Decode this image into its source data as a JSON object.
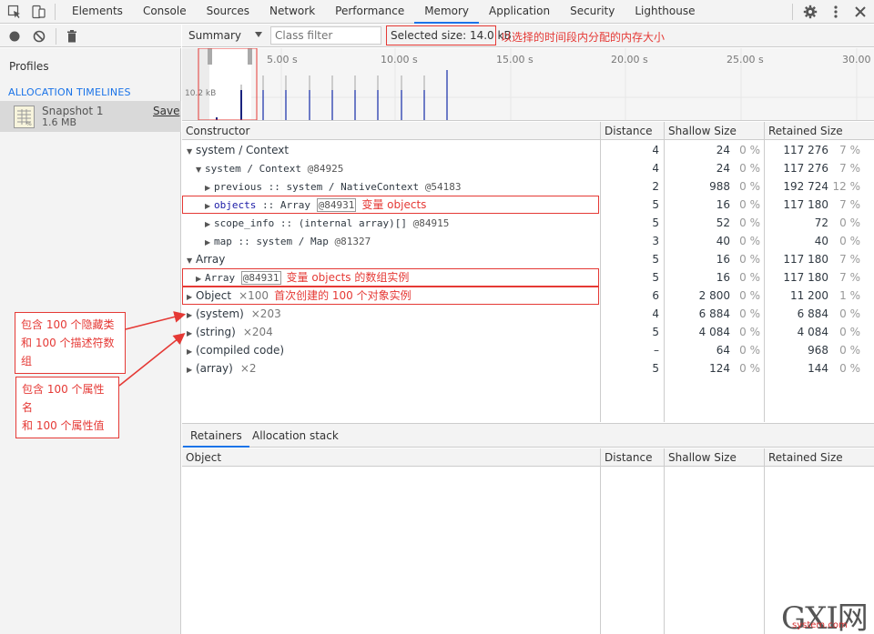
{
  "tabs": [
    {
      "label": "Elements"
    },
    {
      "label": "Console"
    },
    {
      "label": "Sources"
    },
    {
      "label": "Network"
    },
    {
      "label": "Performance"
    },
    {
      "label": "Memory",
      "active": true
    },
    {
      "label": "Application"
    },
    {
      "label": "Security"
    },
    {
      "label": "Lighthouse"
    }
  ],
  "sidebar": {
    "title": "Profiles",
    "section": "ALLOCATION TIMELINES",
    "snapshot": {
      "name": "Snapshot 1",
      "size": "1.6 MB",
      "save_label": "Save"
    }
  },
  "toolbar": {
    "view_select": "Summary",
    "class_filter_placeholder": "Class filter",
    "selected_size": "Selected size: 14.0 kB",
    "selected_size_annotation": "以选择的时间段内分配的内存大小"
  },
  "timeline": {
    "ticks": [
      "5.00 s",
      "10.00 s",
      "15.00 s",
      "20.00 s",
      "25.00 s",
      "30.00 s"
    ],
    "y_label": "10.2 kB"
  },
  "columns": {
    "constructor": "Constructor",
    "distance": "Distance",
    "shallow": "Shallow Size",
    "retained": "Retained Size"
  },
  "rows": [
    {
      "indent": 0,
      "expanded": true,
      "name": "system / Context",
      "distance": "4",
      "shallow": "24",
      "shallow_pct": "0 %",
      "retained": "117 276",
      "retained_pct": "7 %"
    },
    {
      "indent": 1,
      "expanded": true,
      "name": "system / Context",
      "id": "@84925",
      "distance": "4",
      "shallow": "24",
      "shallow_pct": "0 %",
      "retained": "117 276",
      "retained_pct": "7 %"
    },
    {
      "indent": 2,
      "expanded": false,
      "prop": "previous",
      "sep": " :: ",
      "name": "system / NativeContext",
      "id": "@54183",
      "distance": "2",
      "shallow": "988",
      "shallow_pct": "0 %",
      "retained": "192 724",
      "retained_pct": "12 %"
    },
    {
      "indent": 2,
      "expanded": false,
      "prop": "objects",
      "sep": " :: ",
      "name": "Array",
      "boxed_id": "@84931",
      "annotation": "变量 objects",
      "distance": "5",
      "shallow": "16",
      "shallow_pct": "0 %",
      "retained": "117 180",
      "retained_pct": "7 %"
    },
    {
      "indent": 2,
      "expanded": false,
      "prop": "scope_info",
      "sep": " :: ",
      "name": "(internal array)[]",
      "id": "@84915",
      "distance": "5",
      "shallow": "52",
      "shallow_pct": "0 %",
      "retained": "72",
      "retained_pct": "0 %"
    },
    {
      "indent": 2,
      "expanded": false,
      "prop": "map",
      "sep": " :: ",
      "name": "system / Map",
      "id": "@81327",
      "distance": "3",
      "shallow": "40",
      "shallow_pct": "0 %",
      "retained": "40",
      "retained_pct": "0 %"
    },
    {
      "indent": 0,
      "expanded": true,
      "name": "Array",
      "distance": "5",
      "shallow": "16",
      "shallow_pct": "0 %",
      "retained": "117 180",
      "retained_pct": "7 %"
    },
    {
      "indent": 1,
      "expanded": false,
      "name": "Array",
      "boxed_id": "@84931",
      "annotation": "变量 objects 的数组实例",
      "distance": "5",
      "shallow": "16",
      "shallow_pct": "0 %",
      "retained": "117 180",
      "retained_pct": "7 %"
    },
    {
      "indent": 0,
      "expanded": false,
      "name": "Object",
      "count": "×100",
      "annotation": "首次创建的 100 个对象实例",
      "distance": "6",
      "shallow": "2 800",
      "shallow_pct": "0 %",
      "retained": "11 200",
      "retained_pct": "1 %"
    },
    {
      "indent": 0,
      "expanded": false,
      "name": "(system)",
      "count": "×203",
      "distance": "4",
      "shallow": "6 884",
      "shallow_pct": "0 %",
      "retained": "6 884",
      "retained_pct": "0 %"
    },
    {
      "indent": 0,
      "expanded": false,
      "name": "(string)",
      "count": "×204",
      "distance": "5",
      "shallow": "4 084",
      "shallow_pct": "0 %",
      "retained": "4 084",
      "retained_pct": "0 %"
    },
    {
      "indent": 0,
      "expanded": false,
      "name": "(compiled code)",
      "distance": "–",
      "shallow": "64",
      "shallow_pct": "0 %",
      "retained": "968",
      "retained_pct": "0 %"
    },
    {
      "indent": 0,
      "expanded": false,
      "name": "(array)",
      "count": "×2",
      "distance": "5",
      "shallow": "124",
      "shallow_pct": "0 %",
      "retained": "144",
      "retained_pct": "0 %"
    }
  ],
  "bottom": {
    "tabs": [
      {
        "label": "Retainers",
        "active": true
      },
      {
        "label": "Allocation stack"
      }
    ],
    "columns": {
      "object": "Object",
      "distance": "Distance",
      "shallow": "Shallow Size",
      "retained": "Retained Size"
    }
  },
  "callouts": {
    "one_l1": "包含 100 个隐藏类",
    "one_l2": "和 100 个描述符数组",
    "two_l1": "包含 100 个属性名",
    "two_l2": "和 100 个属性值"
  },
  "watermark": {
    "big": "GXI网",
    "small": "system.com"
  },
  "colors": {
    "accent": "#1a73e8",
    "annotation": "#e53935",
    "bar": "#3f51b5"
  }
}
